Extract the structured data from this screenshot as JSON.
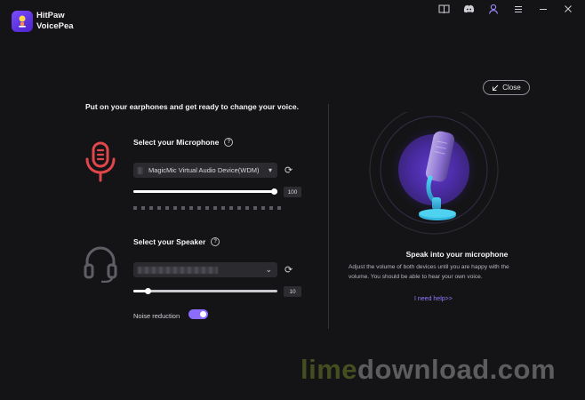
{
  "app": {
    "title_line1": "HitPaw",
    "title_line2": "VoicePea"
  },
  "header": {
    "icons": [
      "book-icon",
      "discord-icon",
      "user-icon",
      "menu-icon",
      "minimize-icon",
      "close-window-icon"
    ]
  },
  "close_button": {
    "label": "Close"
  },
  "intro_text": "Put on your earphones and get ready to change your voice.",
  "microphone": {
    "title": "Select your Microphone",
    "device": "MagicMic Virtual Audio Device(WDM)",
    "volume": "100",
    "volume_fraction": 1.0,
    "meter_segments": 19
  },
  "speaker": {
    "title": "Select your Speaker",
    "volume": "10",
    "volume_fraction": 0.1
  },
  "noise_reduction": {
    "label": "Noise reduction",
    "enabled": true
  },
  "right_panel": {
    "title": "Speak into your microphone",
    "description": "Adjust the volume of both devices until you are happy with the volume. You should be able to hear your own voice.",
    "help_link": "I need help>>"
  },
  "watermark": {
    "part1": "lime",
    "part2": "download.com"
  },
  "colors": {
    "accent": "#8b6cff",
    "mic_icon": "#e0464a",
    "link": "#8f7cff",
    "background": "#141416"
  }
}
